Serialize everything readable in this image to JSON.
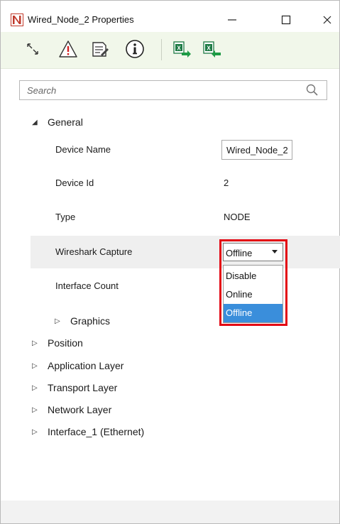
{
  "window": {
    "title": "Wired_Node_2 Properties",
    "minimize_glyph": "—",
    "maximize_glyph": "☐",
    "close_glyph": "✕"
  },
  "toolbar": {
    "icons": [
      "expand-collapse-icon",
      "warning-icon",
      "edit-document-icon",
      "info-icon",
      "excel-export-icon",
      "excel-import-icon"
    ]
  },
  "search": {
    "placeholder": "Search"
  },
  "tree": {
    "general": {
      "label": "General",
      "caret": "◢",
      "properties": [
        {
          "label": "Device Name",
          "value": "Wired_Node_2"
        },
        {
          "label": "Device Id",
          "value": "2"
        },
        {
          "label": "Type",
          "value": "NODE"
        },
        {
          "label": "Wireshark Capture",
          "value": "Offline"
        },
        {
          "label": "Interface Count",
          "value": ""
        }
      ],
      "graphics": {
        "label": "Graphics",
        "caret": "▷"
      }
    },
    "sections": [
      {
        "label": "Position",
        "caret": "▷"
      },
      {
        "label": "Application Layer",
        "caret": "▷"
      },
      {
        "label": "Transport Layer",
        "caret": "▷"
      },
      {
        "label": "Network Layer",
        "caret": "▷"
      },
      {
        "label": "Interface_1 (Ethernet)",
        "caret": "▷"
      }
    ]
  },
  "dropdown": {
    "selected": "Offline",
    "options": [
      "Disable",
      "Online",
      "Offline"
    ],
    "highlight_color": "#e30613",
    "selected_option_color": "#3a8edb"
  },
  "colors": {
    "toolbar_bg": "#f1f7ea",
    "row_highlight": "#efefef"
  }
}
